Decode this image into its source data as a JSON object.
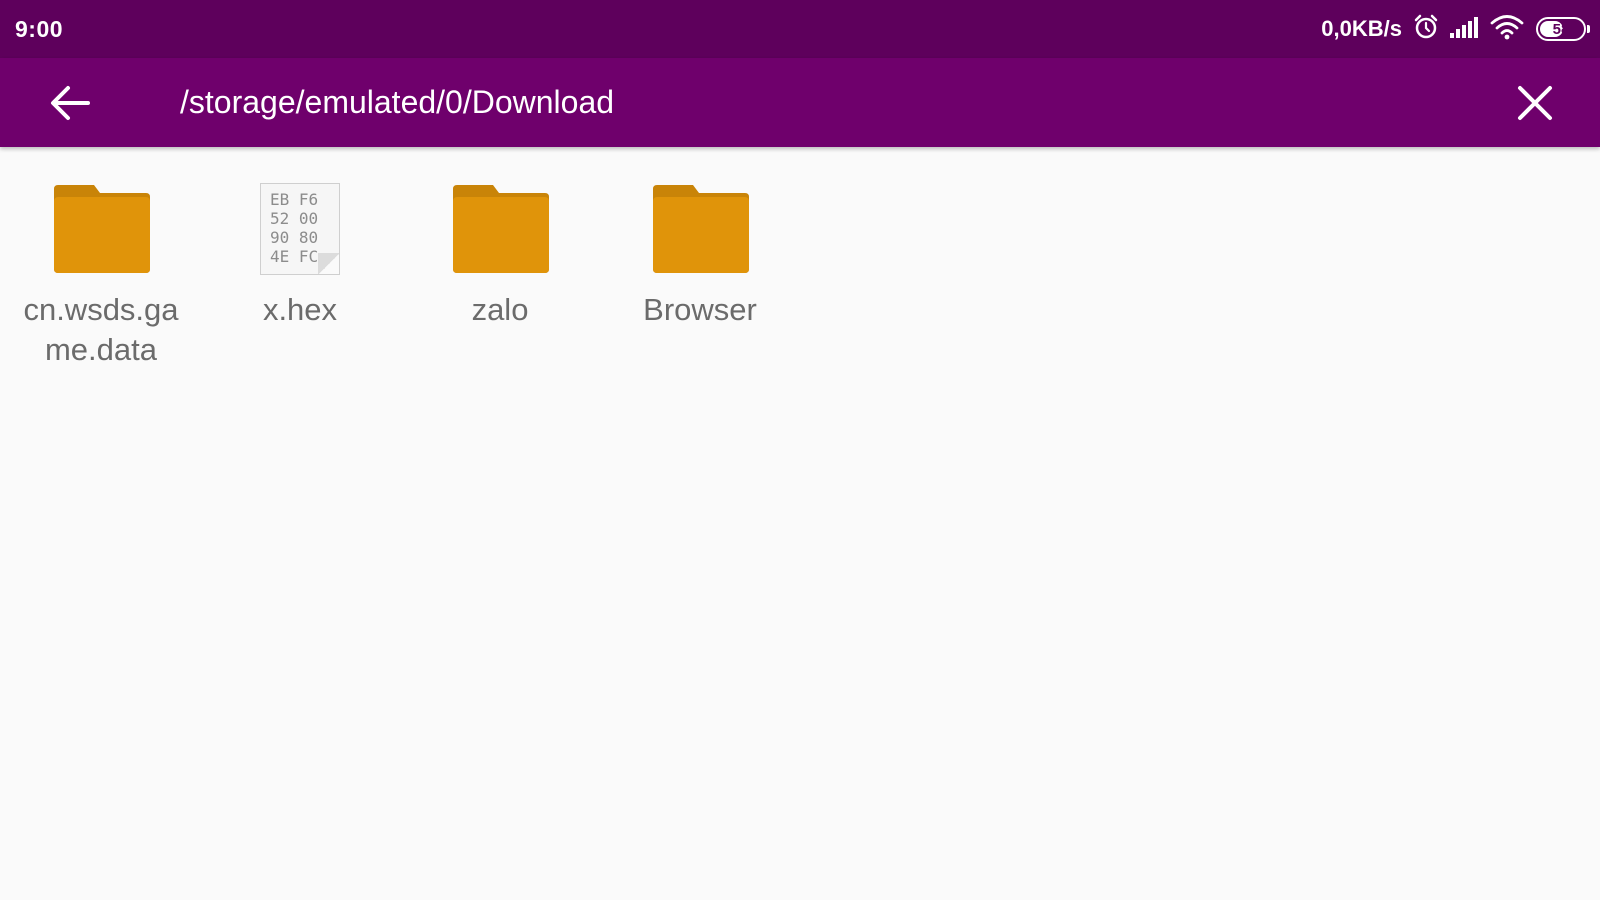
{
  "status_bar": {
    "time": "9:00",
    "net_speed": "0,0KB/s",
    "battery_level": "58",
    "battery_fraction": 0.58,
    "icons": [
      "alarm-icon",
      "signal-icon",
      "wifi-icon",
      "battery-icon"
    ]
  },
  "app_bar": {
    "path": "/storage/emulated/0/Download",
    "back_icon": "arrow-left-icon",
    "close_icon": "close-icon"
  },
  "files": [
    {
      "name": "cn.wsds.game.data",
      "type": "folder"
    },
    {
      "name": "x.hex",
      "type": "hex-file",
      "preview_lines": [
        "EB F6",
        "52 00",
        "90 80",
        "4E FC"
      ]
    },
    {
      "name": "zalo",
      "type": "folder"
    },
    {
      "name": "Browser",
      "type": "folder"
    }
  ],
  "colors": {
    "status_bar": "#5e005c",
    "app_bar": "#6f006c",
    "folder": "#e0940a",
    "folder_tab": "#c98408",
    "background": "#fafafa"
  }
}
